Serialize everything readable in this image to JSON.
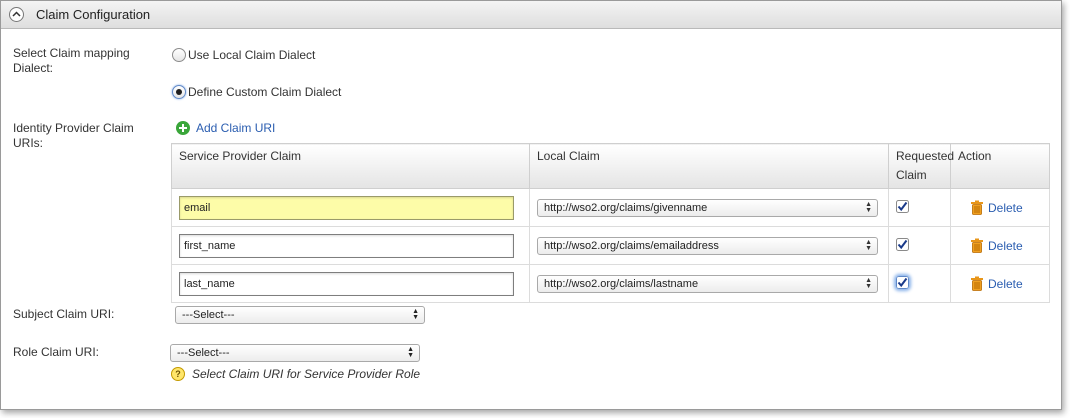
{
  "panel": {
    "title": "Claim Configuration"
  },
  "mapping": {
    "label": "Select Claim mapping Dialect:",
    "option_local": "Use Local Claim Dialect",
    "option_custom": "Define Custom Claim Dialect",
    "selected": "custom"
  },
  "idp": {
    "label": "Identity Provider Claim URIs:",
    "add_link": "Add Claim URI"
  },
  "table": {
    "headers": {
      "sp_claim": "Service Provider Claim",
      "local_claim": "Local Claim",
      "requested_claim": "Requested Claim",
      "action": "Action"
    },
    "rows": [
      {
        "sp_claim": "email",
        "local_claim": "http://wso2.org/claims/givenname",
        "requested": true,
        "action": "Delete"
      },
      {
        "sp_claim": "first_name",
        "local_claim": "http://wso2.org/claims/emailaddress",
        "requested": true,
        "action": "Delete"
      },
      {
        "sp_claim": "last_name",
        "local_claim": "http://wso2.org/claims/lastname",
        "requested": true,
        "action": "Delete"
      }
    ]
  },
  "subject": {
    "label": "Subject Claim URI:",
    "value": "---Select---"
  },
  "role": {
    "label": "Role Claim URI:",
    "value": "---Select---",
    "help": "Select Claim URI for Service Provider Role"
  },
  "colors": {
    "link": "#2a5db0",
    "focus_field": "#fdfca8",
    "add_icon": "#3aa63a",
    "trash_icon": "#e8961a"
  }
}
